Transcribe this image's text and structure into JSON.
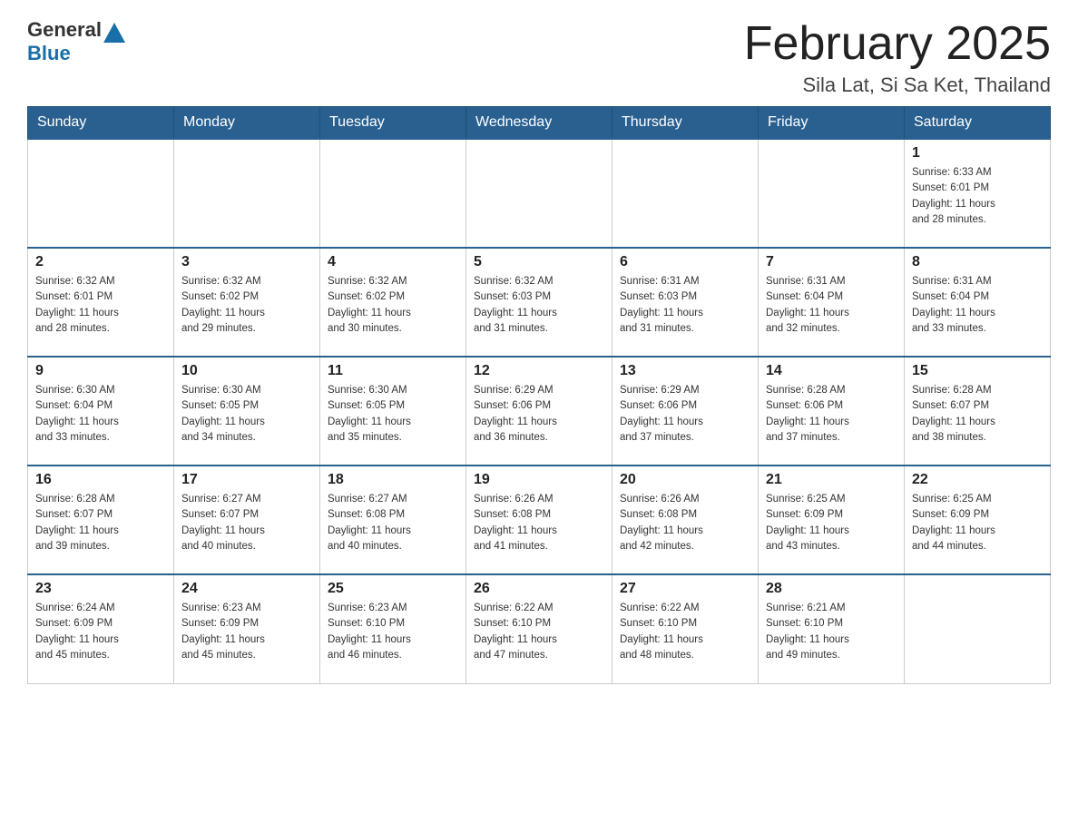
{
  "header": {
    "logo_text_general": "General",
    "logo_text_blue": "Blue",
    "month_title": "February 2025",
    "subtitle": "Sila Lat, Si Sa Ket, Thailand"
  },
  "days_of_week": [
    "Sunday",
    "Monday",
    "Tuesday",
    "Wednesday",
    "Thursday",
    "Friday",
    "Saturday"
  ],
  "weeks": [
    [
      {
        "day": "",
        "info": ""
      },
      {
        "day": "",
        "info": ""
      },
      {
        "day": "",
        "info": ""
      },
      {
        "day": "",
        "info": ""
      },
      {
        "day": "",
        "info": ""
      },
      {
        "day": "",
        "info": ""
      },
      {
        "day": "1",
        "info": "Sunrise: 6:33 AM\nSunset: 6:01 PM\nDaylight: 11 hours\nand 28 minutes."
      }
    ],
    [
      {
        "day": "2",
        "info": "Sunrise: 6:32 AM\nSunset: 6:01 PM\nDaylight: 11 hours\nand 28 minutes."
      },
      {
        "day": "3",
        "info": "Sunrise: 6:32 AM\nSunset: 6:02 PM\nDaylight: 11 hours\nand 29 minutes."
      },
      {
        "day": "4",
        "info": "Sunrise: 6:32 AM\nSunset: 6:02 PM\nDaylight: 11 hours\nand 30 minutes."
      },
      {
        "day": "5",
        "info": "Sunrise: 6:32 AM\nSunset: 6:03 PM\nDaylight: 11 hours\nand 31 minutes."
      },
      {
        "day": "6",
        "info": "Sunrise: 6:31 AM\nSunset: 6:03 PM\nDaylight: 11 hours\nand 31 minutes."
      },
      {
        "day": "7",
        "info": "Sunrise: 6:31 AM\nSunset: 6:04 PM\nDaylight: 11 hours\nand 32 minutes."
      },
      {
        "day": "8",
        "info": "Sunrise: 6:31 AM\nSunset: 6:04 PM\nDaylight: 11 hours\nand 33 minutes."
      }
    ],
    [
      {
        "day": "9",
        "info": "Sunrise: 6:30 AM\nSunset: 6:04 PM\nDaylight: 11 hours\nand 33 minutes."
      },
      {
        "day": "10",
        "info": "Sunrise: 6:30 AM\nSunset: 6:05 PM\nDaylight: 11 hours\nand 34 minutes."
      },
      {
        "day": "11",
        "info": "Sunrise: 6:30 AM\nSunset: 6:05 PM\nDaylight: 11 hours\nand 35 minutes."
      },
      {
        "day": "12",
        "info": "Sunrise: 6:29 AM\nSunset: 6:06 PM\nDaylight: 11 hours\nand 36 minutes."
      },
      {
        "day": "13",
        "info": "Sunrise: 6:29 AM\nSunset: 6:06 PM\nDaylight: 11 hours\nand 37 minutes."
      },
      {
        "day": "14",
        "info": "Sunrise: 6:28 AM\nSunset: 6:06 PM\nDaylight: 11 hours\nand 37 minutes."
      },
      {
        "day": "15",
        "info": "Sunrise: 6:28 AM\nSunset: 6:07 PM\nDaylight: 11 hours\nand 38 minutes."
      }
    ],
    [
      {
        "day": "16",
        "info": "Sunrise: 6:28 AM\nSunset: 6:07 PM\nDaylight: 11 hours\nand 39 minutes."
      },
      {
        "day": "17",
        "info": "Sunrise: 6:27 AM\nSunset: 6:07 PM\nDaylight: 11 hours\nand 40 minutes."
      },
      {
        "day": "18",
        "info": "Sunrise: 6:27 AM\nSunset: 6:08 PM\nDaylight: 11 hours\nand 40 minutes."
      },
      {
        "day": "19",
        "info": "Sunrise: 6:26 AM\nSunset: 6:08 PM\nDaylight: 11 hours\nand 41 minutes."
      },
      {
        "day": "20",
        "info": "Sunrise: 6:26 AM\nSunset: 6:08 PM\nDaylight: 11 hours\nand 42 minutes."
      },
      {
        "day": "21",
        "info": "Sunrise: 6:25 AM\nSunset: 6:09 PM\nDaylight: 11 hours\nand 43 minutes."
      },
      {
        "day": "22",
        "info": "Sunrise: 6:25 AM\nSunset: 6:09 PM\nDaylight: 11 hours\nand 44 minutes."
      }
    ],
    [
      {
        "day": "23",
        "info": "Sunrise: 6:24 AM\nSunset: 6:09 PM\nDaylight: 11 hours\nand 45 minutes."
      },
      {
        "day": "24",
        "info": "Sunrise: 6:23 AM\nSunset: 6:09 PM\nDaylight: 11 hours\nand 45 minutes."
      },
      {
        "day": "25",
        "info": "Sunrise: 6:23 AM\nSunset: 6:10 PM\nDaylight: 11 hours\nand 46 minutes."
      },
      {
        "day": "26",
        "info": "Sunrise: 6:22 AM\nSunset: 6:10 PM\nDaylight: 11 hours\nand 47 minutes."
      },
      {
        "day": "27",
        "info": "Sunrise: 6:22 AM\nSunset: 6:10 PM\nDaylight: 11 hours\nand 48 minutes."
      },
      {
        "day": "28",
        "info": "Sunrise: 6:21 AM\nSunset: 6:10 PM\nDaylight: 11 hours\nand 49 minutes."
      },
      {
        "day": "",
        "info": ""
      }
    ]
  ]
}
